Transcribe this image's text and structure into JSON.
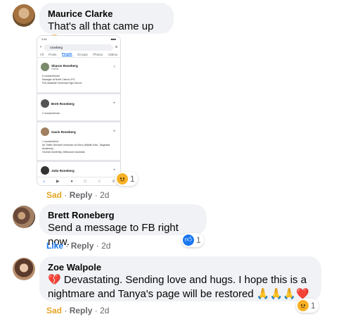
{
  "comments": [
    {
      "author": "Maurice Clarke",
      "text": "That's all that came up 😔",
      "reaction": {
        "label": "Sad",
        "reply": "Reply",
        "time": "2d",
        "count": "1"
      }
    },
    {
      "author": "Brett Roneberg",
      "text": "Send a message to FB right now.",
      "reaction": {
        "label": "Like",
        "reply": "Reply",
        "time": "2d",
        "count": "1"
      }
    },
    {
      "author": "Zoe Walpole",
      "text_line1": "💔 Devastating. Sending love and hugs. I hope this is a",
      "text_line2": "nightmare and Tanya's page will be restored 🙏🙏🙏❤️",
      "reaction": {
        "label": "Sad",
        "reply": "Reply",
        "time": "2d",
        "count": "1"
      }
    }
  ],
  "separator": "·",
  "screenshot": {
    "status_time": "2:41",
    "status_right": "■■■",
    "search_value": "roneberg",
    "tabs": [
      "All",
      "Posts",
      "People",
      "Groups",
      "Photos",
      "Videos"
    ],
    "results": [
      {
        "name": "Sharon Roneberg",
        "sub": "Friend",
        "details": [
          "6 mutual friends",
          "Manager at North Cairns LPO",
          "Port Adelaide Technical High School"
        ]
      },
      {
        "name": "Brett Roneberg",
        "sub": "",
        "details": [
          "2 mutual friends"
        ]
      },
      {
        "name": "Gavin Roneberg",
        "sub": "",
        "details": [
          "1 mutual friend",
          "Air Traffic Services Instructor at Serco (Middle East - Baghdad Academy)",
          "Victoria University, Melbourne Australia"
        ]
      },
      {
        "name": "João Roneberg",
        "sub": "",
        "details": []
      }
    ]
  },
  "colors": {
    "accent": "#1877f2",
    "bubble": "#f0f2f5",
    "meta": "#65676b",
    "sad": "#e5a524",
    "like": "#1877f2"
  }
}
